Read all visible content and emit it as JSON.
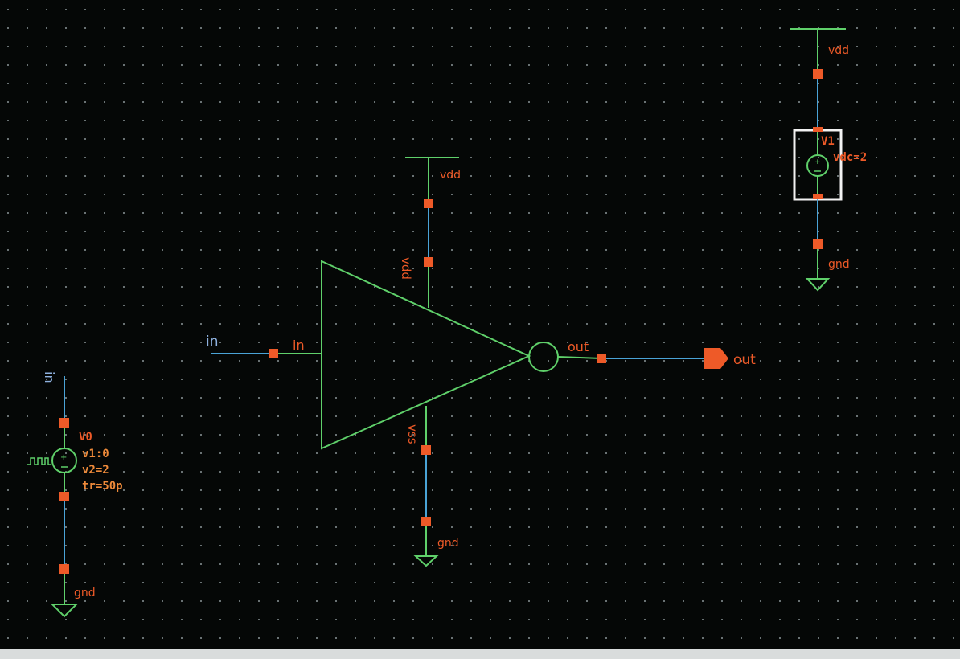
{
  "colors": {
    "background": "#050706",
    "grid": "#9aa3a6",
    "symbol": "#5fd06a",
    "wire": "#4aa3d6",
    "pin": "#ee5a28",
    "label": "#ee5a28",
    "net_label": "#8fb2e0",
    "selection": "#f2f2f2"
  },
  "inverter": {
    "in_pin": "in",
    "out_pin": "out",
    "vdd_pin": "vdd",
    "vss_pin": "vss"
  },
  "nets": {
    "in_wire": "in",
    "out_wire": "out",
    "out_port": "out",
    "inv_vdd": "vdd",
    "inv_gnd": "gnd"
  },
  "v0": {
    "net_top": "in",
    "name": "V0",
    "v1": "v1:0",
    "v2": "v2=2",
    "tr": "tr=50p",
    "gnd": "gnd"
  },
  "v1": {
    "vdd": "vdd",
    "name": "V1",
    "vdc": "vdc=2",
    "gnd": "gnd"
  }
}
